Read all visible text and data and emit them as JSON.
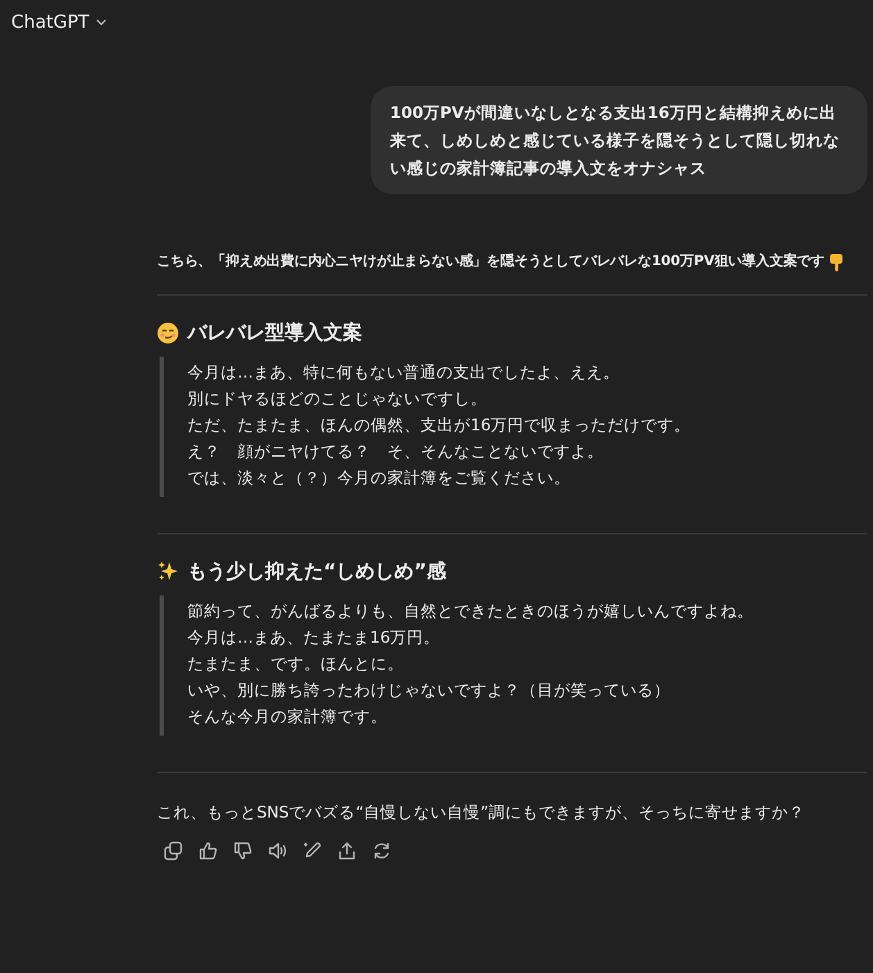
{
  "header": {
    "title": "ChatGPT"
  },
  "user_message": {
    "text": "100万PVが間違いなしとなる支出16万円と結構抑えめに出来て、しめしめと感じている様子を隠そうとして隠し切れない感じの家計簿記事の導入文をオナシャス"
  },
  "reply": {
    "intro": "こちら、**「抑えめ出費に内心ニヤけが止まらない感」**を隠そうとして**バレバレ**な100万PV狙い導入文案です",
    "sections": [
      {
        "kind": "smirk",
        "heading": "バレバレ型導入文案",
        "lines": [
          "今月は…まあ、特に何もない普通の支出でしたよ、ええ。",
          "別にドヤるほどのことじゃないですし。",
          "ただ、たまたま、ほんの偶然、支出が16万円で収まっただけです。",
          "え？　顔がニヤけてる？　そ、そんなことないですよ。",
          "では、淡々と（？）今月の家計簿をご覧ください。"
        ]
      },
      {
        "kind": "sparkles",
        "heading": "もう少し抑えた“しめしめ”感",
        "lines": [
          "節約って、がんばるよりも、自然とできたときのほうが嬉しいんですよね。",
          "今月は…まあ、たまたま16万円。",
          "たまたま、です。ほんとに。",
          "いや、別に勝ち誇ったわけじゃないですよ？（目が笑っている）",
          "そんな今月の家計簿です。"
        ]
      }
    ],
    "closing": "これ、もっとSNSでバズる“自慢しない自慢”調にもできますが、そっちに寄せますか？",
    "actions": [
      {
        "kind": "copy"
      },
      {
        "kind": "thumbs_up"
      },
      {
        "kind": "thumbs_down"
      },
      {
        "kind": "speaker"
      },
      {
        "kind": "edit"
      },
      {
        "kind": "share"
      },
      {
        "kind": "regenerate"
      }
    ]
  }
}
